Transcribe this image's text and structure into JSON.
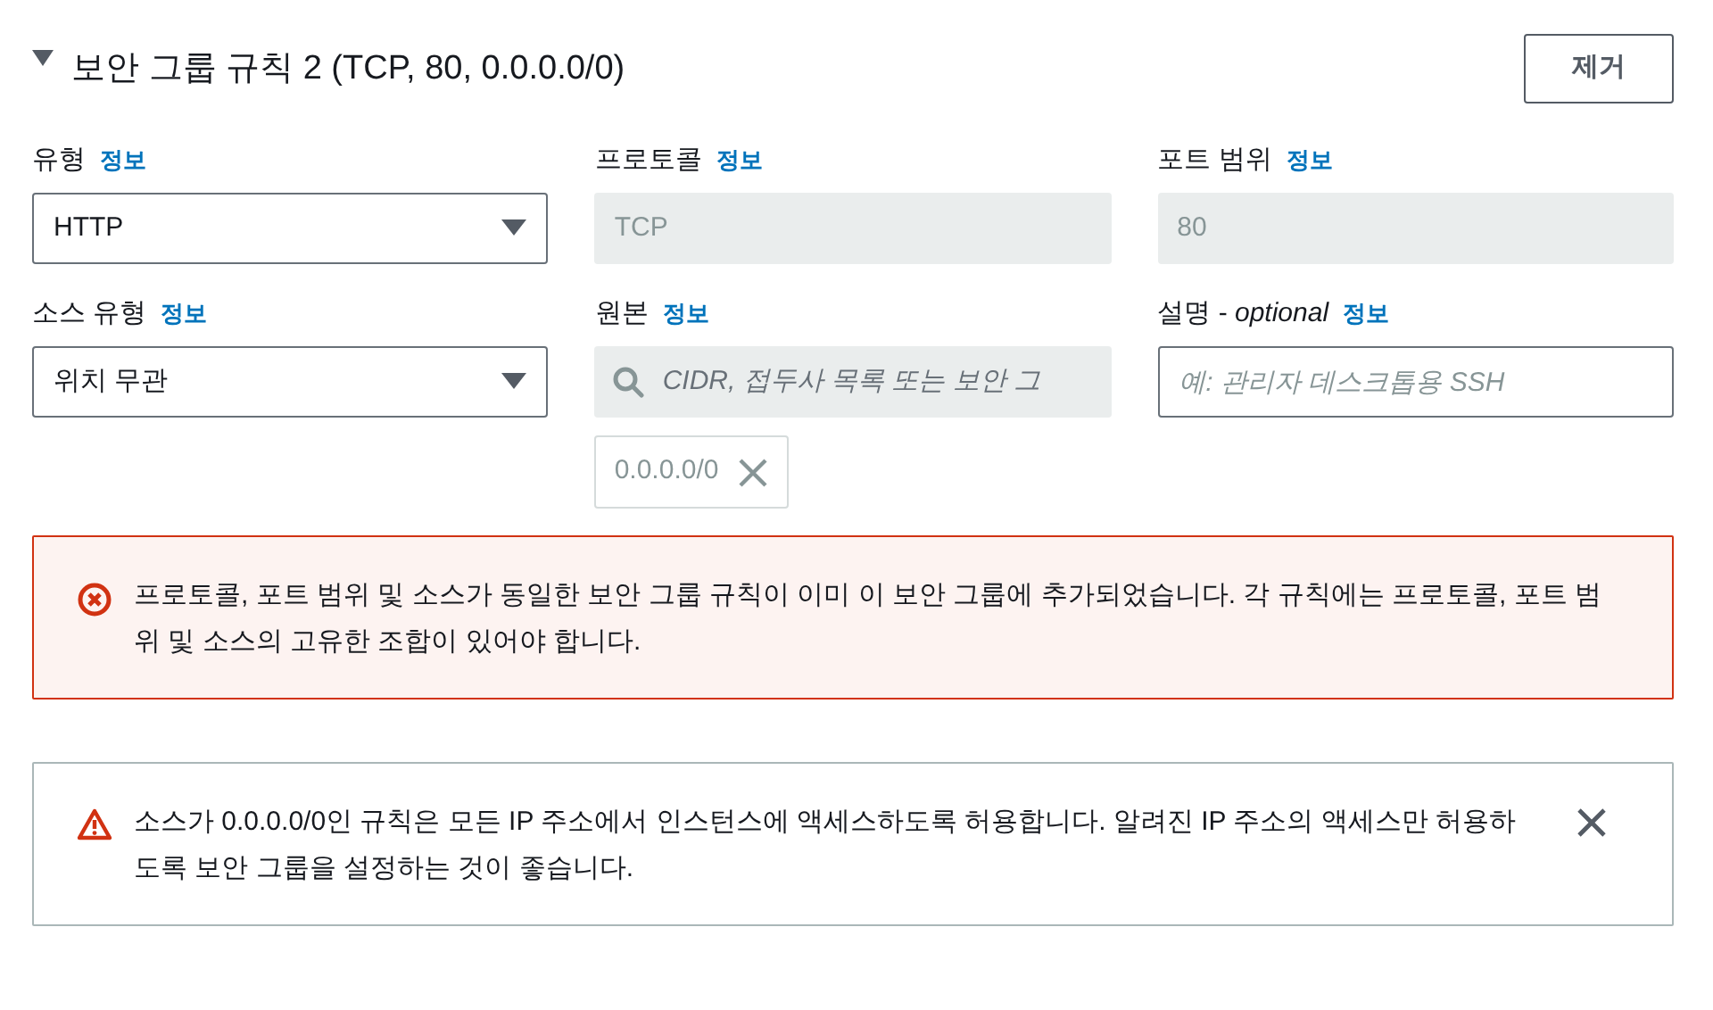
{
  "rule": {
    "title": "보안 그룹 규칙 2 (TCP, 80, 0.0.0.0/0)",
    "expanded": true,
    "remove_button": "제거"
  },
  "fields": [
    {
      "label": "유형",
      "info": "정보",
      "kind": "select",
      "value": "HTTP"
    },
    {
      "label": "프로토콜",
      "info": "정보",
      "kind": "readonly",
      "value": "TCP"
    },
    {
      "label": "포트 범위",
      "info": "정보",
      "kind": "readonly",
      "value": "80"
    },
    {
      "label": "소스 유형",
      "info": "정보",
      "kind": "select",
      "value": "위치 무관"
    },
    {
      "label": "원본",
      "info": "정보",
      "kind": "search",
      "placeholder": "CIDR, 접두사 목록 또는 보안 그",
      "tokens": [
        "0.0.0.0/0"
      ]
    },
    {
      "label": "설명 - *optional*",
      "info": "정보",
      "kind": "text",
      "placeholder": "예: 관리자 데스크톱용 SSH"
    }
  ],
  "alerts": [
    {
      "kind": "error",
      "text": "프로토콜, 포트 범위 및 소스가 동일한 보안 그룹 규칙이 이미 이 보안 그룹에 추가되었습니다. 각 규칙에는 프로토콜, 포트 범위 및 소스의 고유한 조합이 있어야 합니다.",
      "dismissible": false
    },
    {
      "kind": "warning",
      "text": "소스가 0.0.0.0/0인 규칙은 모든 IP 주소에서 인스턴스에 액세스하도록 허용합니다. 알려진 IP 주소의 액세스만 허용하도록 보안 그룹을 설정하는 것이 좋습니다.",
      "dismissible": true
    }
  ]
}
